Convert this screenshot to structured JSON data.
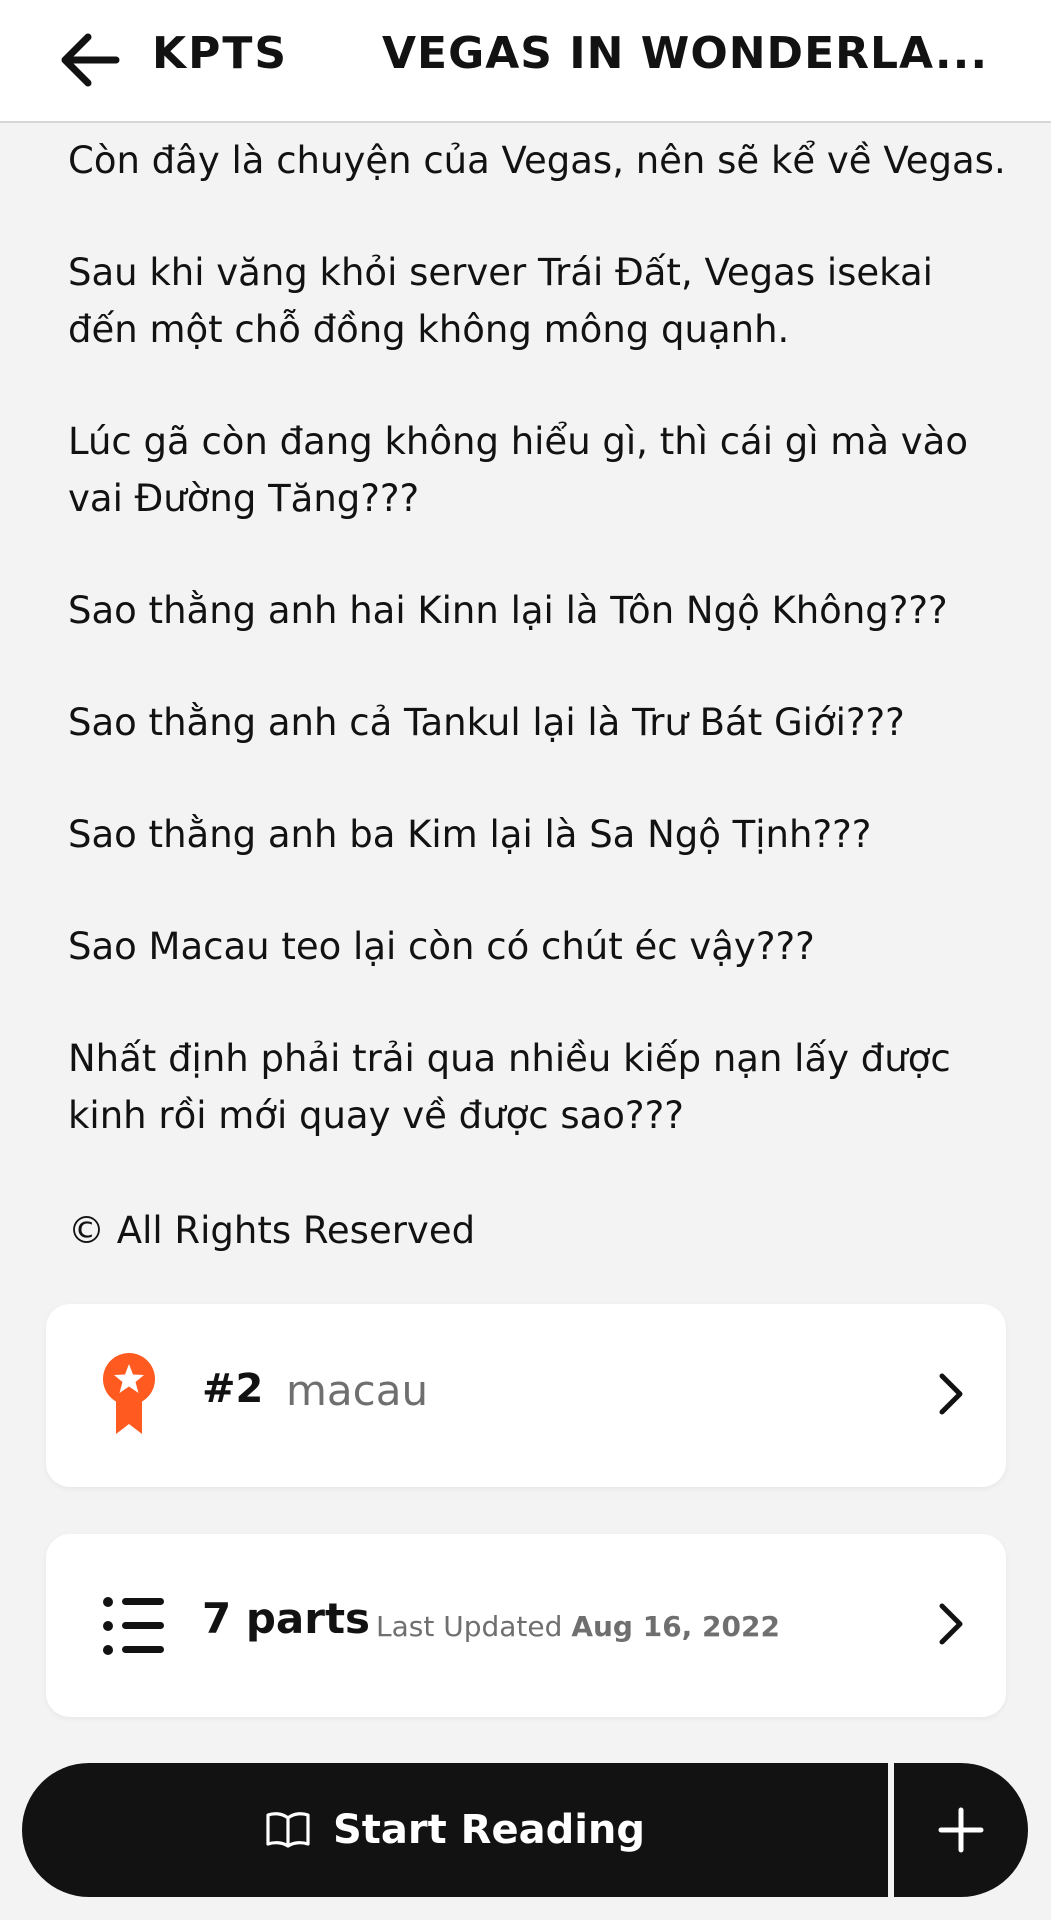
{
  "header": {
    "back_icon": "arrow-left-icon",
    "author": "KPTS",
    "title": "VEGAS IN WONDERLA..."
  },
  "story": {
    "paragraphs": [
      "Còn đây là chuyện của Vegas, nên sẽ kể về Vegas.",
      "Sau khi văng khỏi server Trái Đất, Vegas isekai đến một chỗ đồng không mông quạnh.",
      "Lúc gã còn đang không hiểu gì, thì cái gì mà vào vai Đường Tăng???",
      "Sao thằng anh hai Kinn lại là Tôn Ngộ Không???",
      "Sao thằng anh cả Tankul lại là Trư Bát Giới???",
      "Sao thằng anh ba Kim lại là Sa Ngộ Tịnh???",
      "Sao Macau teo lại còn có chút éc vậy???",
      "Nhất định phải trải qua nhiều kiếp nạn lấy được kinh rồi mới quay về được sao???"
    ],
    "rights": "© All Rights Reserved"
  },
  "ranking": {
    "icon": "award-badge-icon",
    "rank": "#2",
    "tag": "macau"
  },
  "parts": {
    "icon": "list-icon",
    "count": "7 parts",
    "updated_label": "Last Updated",
    "updated_date": "Aug 16, 2022"
  },
  "actions": {
    "start_icon": "book-open-icon",
    "start_label": "Start Reading",
    "add_icon": "plus-icon"
  },
  "colors": {
    "badge_orange": "#ff5a1f",
    "primary_dark": "#121212",
    "background": "#f3f3f3"
  }
}
